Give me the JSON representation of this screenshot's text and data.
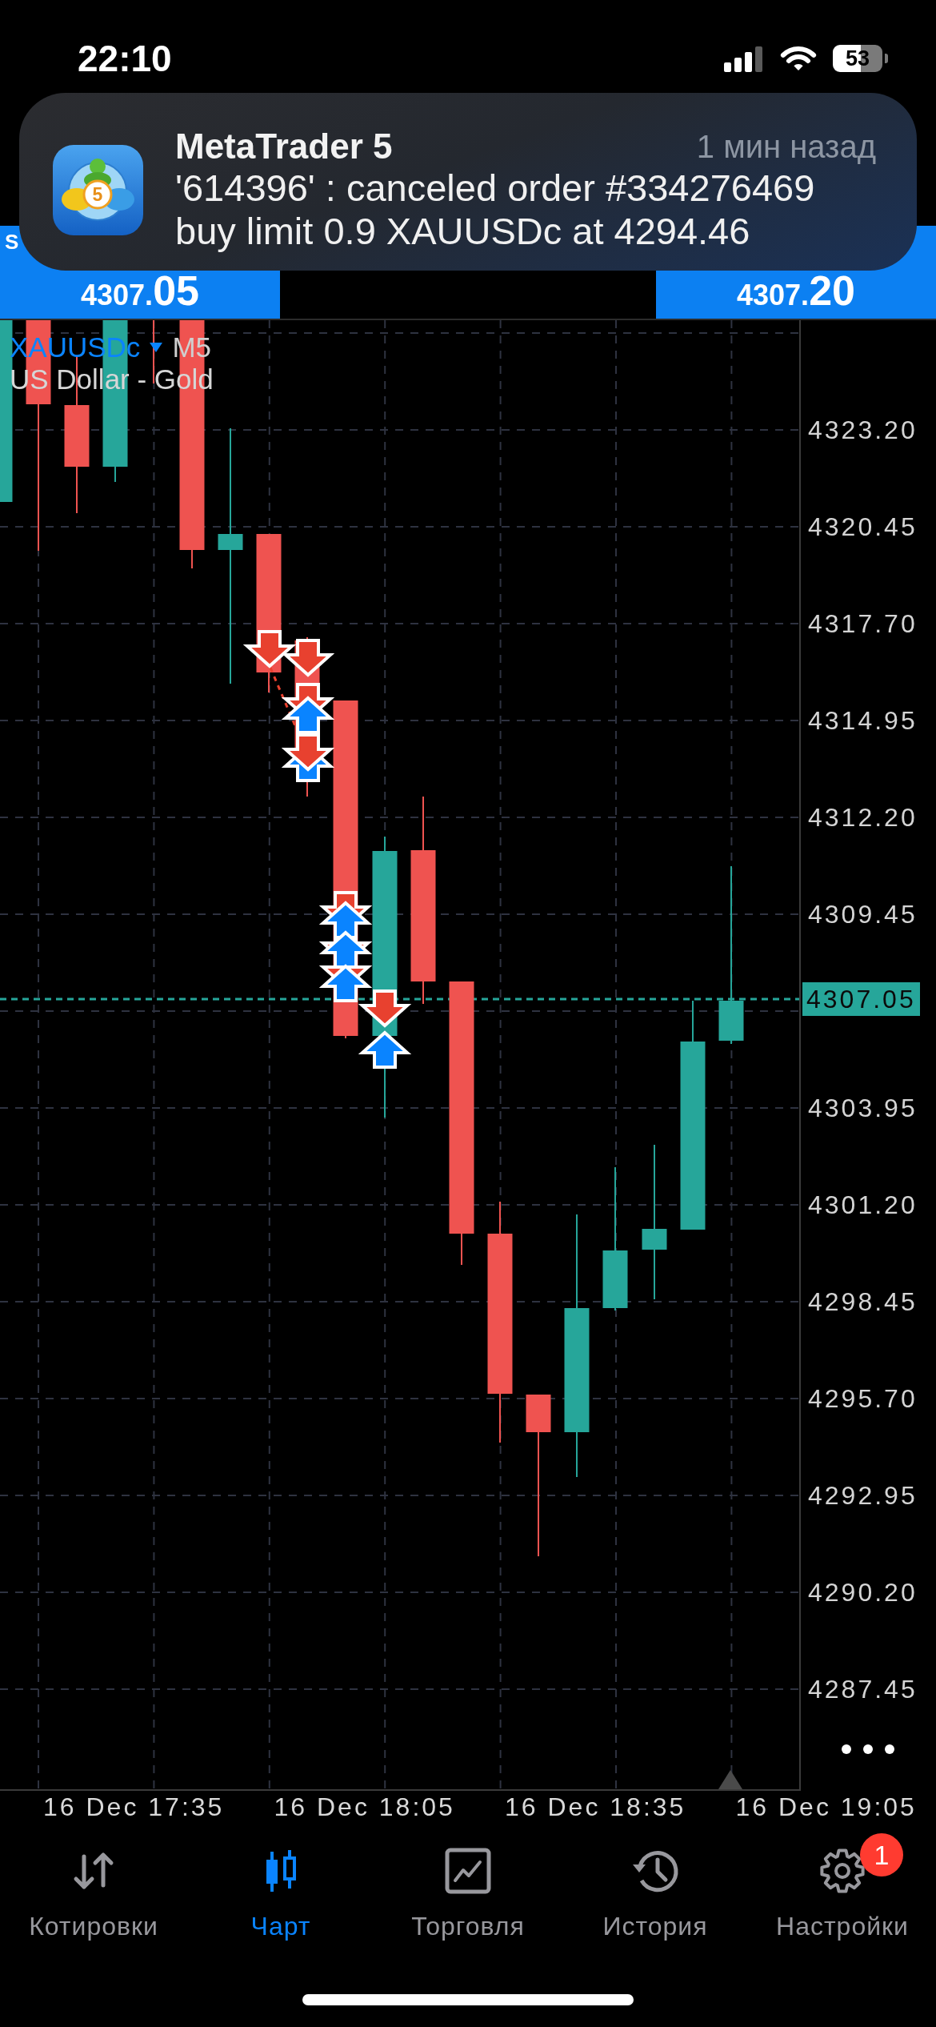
{
  "status_bar": {
    "time": "22:10",
    "battery": "53"
  },
  "notification": {
    "app": "MetaTrader 5",
    "time": "1 мин назад",
    "icon_label": "5",
    "message": "'614396' : canceled order #334276469 buy limit 0.9 XAUUSDc at 4294.46"
  },
  "price_panel": {
    "sell": {
      "label": "S",
      "price": "4307.05"
    },
    "buy": {
      "price": "4307.20"
    }
  },
  "chart": {
    "symbol": "XAUUSDc",
    "timeframe": "M5",
    "description": "US Dollar - Gold",
    "price_axis_above": [
      "4323.20",
      "4320.45",
      "4317.70",
      "4314.95",
      "4312.20",
      "4309.45"
    ],
    "current_price": "4307.05",
    "price_axis_below": [
      "4303.95",
      "4301.20",
      "4298.45",
      "4295.70",
      "4292.95",
      "4290.20",
      "4287.45"
    ],
    "time_axis": [
      "16 Dec 17:35",
      "16 Dec 18:05",
      "16 Dec 18:35",
      "16 Dec 19:05"
    ]
  },
  "tabs": [
    {
      "label": "Котировки",
      "selected": false
    },
    {
      "label": "Чарт",
      "selected": true
    },
    {
      "label": "Торговля",
      "selected": false
    },
    {
      "label": "История",
      "selected": false
    },
    {
      "label": "Настройки",
      "selected": false,
      "badge": "1"
    }
  ]
}
